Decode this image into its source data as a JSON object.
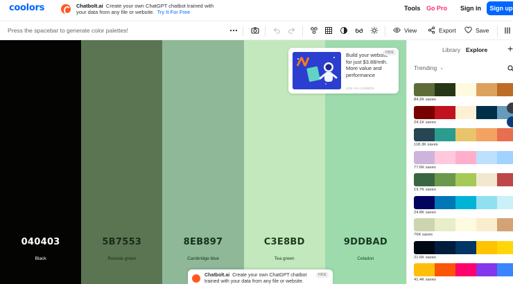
{
  "header": {
    "logo": "coolors",
    "ad": {
      "brand": "Chatbolt.ai",
      "text": "Create your own ChatGPT chatbot trained with your data from any file or website.",
      "cta": "Try It For Free"
    },
    "nav": {
      "tools": "Tools",
      "gopro": "Go Pro",
      "signin": "Sign in",
      "signup": "Sign up"
    }
  },
  "toolbar": {
    "hint": "Press the spacebar to generate color palettes!",
    "view_label": "View",
    "export_label": "Export",
    "save_label": "Save"
  },
  "palette": {
    "swatches": [
      {
        "hex": "040403",
        "name": "Black",
        "color": "#040403",
        "text_color": "#ffffff"
      },
      {
        "hex": "5B7553",
        "name": "Reseda green",
        "color": "#5B7553",
        "text_color": "#1c2a17"
      },
      {
        "hex": "8EB897",
        "name": "Cambridge blue",
        "color": "#8EB897",
        "text_color": "#15301c"
      },
      {
        "hex": "C3E8BD",
        "name": "Tea green",
        "color": "#C3E8BD",
        "text_color": "#1e3b1b"
      },
      {
        "hex": "9DDBAD",
        "name": "Celadon",
        "color": "#9DDBAD",
        "text_color": "#173b22"
      }
    ]
  },
  "ad_card": {
    "hide": "HIDE",
    "text": "Build your website for just $3.88/mth. More value and performance",
    "via": "ADS VIA CARBON"
  },
  "ad_bottom": {
    "brand": "Chatbolt.ai",
    "text": "Create your own ChatGPT chatbot trained with your data from any file or website.",
    "hide": "HIDE"
  },
  "panel": {
    "tab_library": "Library",
    "tab_explore": "Explore",
    "trending": "Trending",
    "palettes": [
      {
        "saves": "84.2K saves",
        "colors": [
          "#606c38",
          "#283618",
          "#fefae0",
          "#dda15e",
          "#bc6c25"
        ]
      },
      {
        "saves": "24.1K saves",
        "colors": [
          "#780000",
          "#c1121f",
          "#fdf0d5",
          "#003049",
          "#669bbc"
        ]
      },
      {
        "saves": "118.3K saves",
        "colors": [
          "#264653",
          "#2a9d8f",
          "#e9c46a",
          "#f4a261",
          "#e76f51"
        ]
      },
      {
        "saves": "77.6K saves",
        "colors": [
          "#cdb4db",
          "#ffc8dd",
          "#ffafcc",
          "#bde0fe",
          "#a2d2ff"
        ]
      },
      {
        "saves": "19.7K saves",
        "colors": [
          "#386641",
          "#6a994e",
          "#a7c957",
          "#f2e8cf",
          "#bc4749"
        ]
      },
      {
        "saves": "24.8K saves",
        "colors": [
          "#03045e",
          "#0077b6",
          "#00b4d8",
          "#90e0ef",
          "#caf0f8"
        ]
      },
      {
        "saves": "76K saves",
        "colors": [
          "#ccd5ae",
          "#e9edc9",
          "#fefae0",
          "#faedcd",
          "#d4a373"
        ]
      },
      {
        "saves": "21.6K saves",
        "colors": [
          "#000814",
          "#001d3d",
          "#003566",
          "#ffc300",
          "#ffd60a"
        ]
      },
      {
        "saves": "41.4K saves",
        "colors": [
          "#ffbe0b",
          "#fb5607",
          "#ff006e",
          "#8338ec",
          "#3a86ff"
        ]
      }
    ]
  }
}
